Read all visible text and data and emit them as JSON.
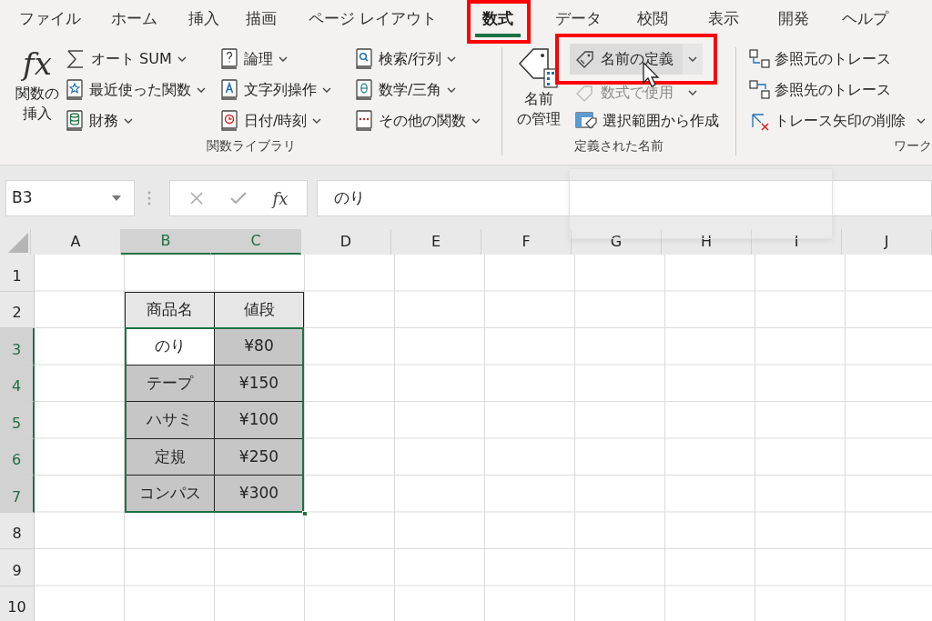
{
  "tabs": [
    {
      "label": "ファイル",
      "selected": false
    },
    {
      "label": "ホーム",
      "selected": false
    },
    {
      "label": "挿入",
      "selected": false
    },
    {
      "label": "描画",
      "selected": false
    },
    {
      "label": "ページ レイアウト",
      "selected": false
    },
    {
      "label": "数式",
      "selected": true
    },
    {
      "label": "データ",
      "selected": false
    },
    {
      "label": "校閲",
      "selected": false
    },
    {
      "label": "表示",
      "selected": false
    },
    {
      "label": "開発",
      "selected": false
    },
    {
      "label": "ヘルプ",
      "selected": false
    }
  ],
  "function_library": {
    "insert_function": {
      "icon_text": "fx",
      "lines": [
        "関数の",
        "挿入"
      ]
    },
    "columns": [
      [
        {
          "label": "オート SUM",
          "dropdown": true
        },
        {
          "label": "最近使った関数",
          "dropdown": true
        },
        {
          "label": "財務",
          "dropdown": true
        }
      ],
      [
        {
          "label": "論理",
          "dropdown": true
        },
        {
          "label": "文字列操作",
          "dropdown": true
        },
        {
          "label": "日付/時刻",
          "dropdown": true
        }
      ],
      [
        {
          "label": "検索/行列",
          "dropdown": true
        },
        {
          "label": "数学/三角",
          "dropdown": true
        },
        {
          "label": "その他の関数",
          "dropdown": true
        }
      ]
    ],
    "group_label": "関数ライブラリ"
  },
  "defined_names": {
    "name_manager": {
      "lines": [
        "名前",
        "の管理"
      ]
    },
    "items": [
      {
        "label": "名前の定義",
        "dropdown": true,
        "hovered": true,
        "disabled": false
      },
      {
        "label": "数式で使用",
        "dropdown": true,
        "hovered": false,
        "disabled": true
      },
      {
        "label": "選択範囲から作成",
        "dropdown": false,
        "hovered": false,
        "disabled": false
      }
    ],
    "group_label": "定義された名前"
  },
  "formula_auditing": {
    "items": [
      {
        "label": "参照元のトレース",
        "dropdown": false
      },
      {
        "label": "参照先のトレース",
        "dropdown": false
      },
      {
        "label": "トレース矢印の削除",
        "dropdown": true
      }
    ],
    "group_label": "ワーク"
  },
  "formula_bar": {
    "name_box": "B3",
    "fx": "fx",
    "value": "のり"
  },
  "columns": [
    {
      "label": "A",
      "selected": false
    },
    {
      "label": "B",
      "selected": true
    },
    {
      "label": "C",
      "selected": true
    },
    {
      "label": "D",
      "selected": false
    },
    {
      "label": "E",
      "selected": false
    },
    {
      "label": "F",
      "selected": false
    },
    {
      "label": "G",
      "selected": false
    },
    {
      "label": "H",
      "selected": false
    },
    {
      "label": "I",
      "selected": false
    },
    {
      "label": "J",
      "selected": false
    }
  ],
  "rows": [
    {
      "label": "1",
      "selected": false
    },
    {
      "label": "2",
      "selected": false
    },
    {
      "label": "3",
      "selected": true
    },
    {
      "label": "4",
      "selected": true
    },
    {
      "label": "5",
      "selected": true
    },
    {
      "label": "6",
      "selected": true
    },
    {
      "label": "7",
      "selected": true
    },
    {
      "label": "8",
      "selected": false
    },
    {
      "label": "9",
      "selected": false
    },
    {
      "label": "10",
      "selected": false
    }
  ],
  "table": {
    "header": [
      "商品名",
      "値段"
    ],
    "rows": [
      {
        "selected": true,
        "cells": [
          {
            "text": "のり",
            "active": true
          },
          {
            "text": "¥80",
            "active": false
          }
        ]
      },
      {
        "selected": true,
        "cells": [
          {
            "text": "テープ",
            "active": false
          },
          {
            "text": "¥150",
            "active": false
          }
        ]
      },
      {
        "selected": true,
        "cells": [
          {
            "text": "ハサミ",
            "active": false
          },
          {
            "text": "¥100",
            "active": false
          }
        ]
      },
      {
        "selected": true,
        "cells": [
          {
            "text": "定規",
            "active": false
          },
          {
            "text": "¥250",
            "active": false
          }
        ]
      },
      {
        "selected": true,
        "cells": [
          {
            "text": "コンパス",
            "active": false
          },
          {
            "text": "¥300",
            "active": false
          }
        ]
      }
    ]
  }
}
